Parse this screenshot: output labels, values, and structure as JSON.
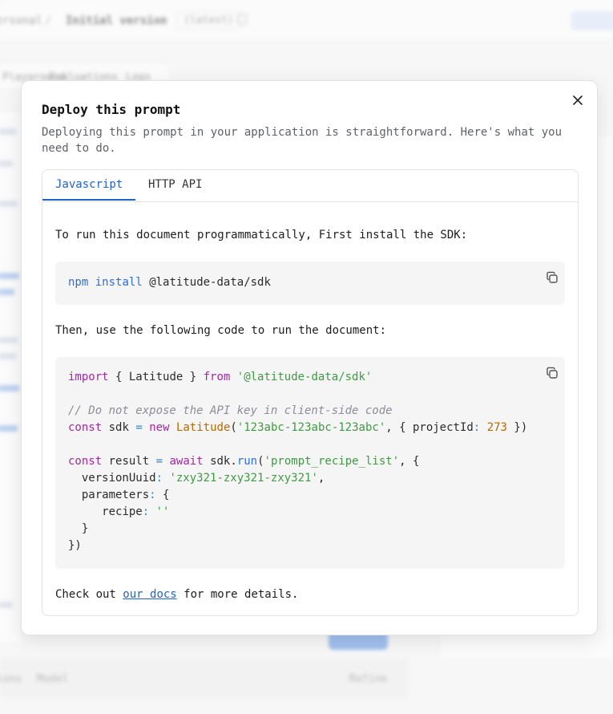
{
  "background": {
    "breadcrumb_first": "ersonal",
    "breadcrumb_separator": "/",
    "breadcrumb_current": "Initial version",
    "version_badge": "(latest)",
    "tabs": [
      "Playground",
      "Evaluations",
      "Logs"
    ],
    "bottom_left": "ions",
    "bottom_mid": "Model",
    "bottom_right": "Refine"
  },
  "dialog": {
    "title": "Deploy this prompt",
    "description": "Deploying this prompt in your application is straightforward. Here's what you need to do.",
    "tabs": [
      {
        "label": "Javascript",
        "active": true
      },
      {
        "label": "HTTP API",
        "active": false
      }
    ],
    "install_intro": "To run this document programmatically, First install the SDK:",
    "install_cmd": {
      "npm": "npm",
      "install": "install",
      "package": "@latitude-data/sdk"
    },
    "usage_intro": "Then, use the following code to run the document:",
    "code": {
      "import_kw": "import",
      "import_names": "{ Latitude }",
      "from_kw": "from",
      "import_path": "'@latitude-data/sdk'",
      "comment": "// Do not expose the API key in client-side code",
      "const_kw": "const",
      "sdk_var": "sdk",
      "eq": "=",
      "new_kw": "new",
      "class_name": "Latitude",
      "api_key": "'123abc-123abc-123abc'",
      "project_key": "projectId",
      "project_id": "273",
      "result_var": "result",
      "await_kw": "await",
      "run_method": "run",
      "document_path": "'prompt_recipe_list'",
      "version_key": "versionUuid",
      "version_value": "'zxy321-zxy321-zxy321'",
      "parameters_key": "parameters",
      "recipe_key": "recipe",
      "recipe_value": "''"
    },
    "footer_prefix": "Check out ",
    "footer_link": "our docs",
    "footer_suffix": " for more details."
  },
  "colors": {
    "accent": "#2063c8",
    "keyword": "#a626a4",
    "string": "#3f9a42",
    "function": "#2f6fcf",
    "number": "#b46a00",
    "comment": "#8b8e94"
  },
  "icons": [
    "close-icon",
    "copy-icon"
  ]
}
